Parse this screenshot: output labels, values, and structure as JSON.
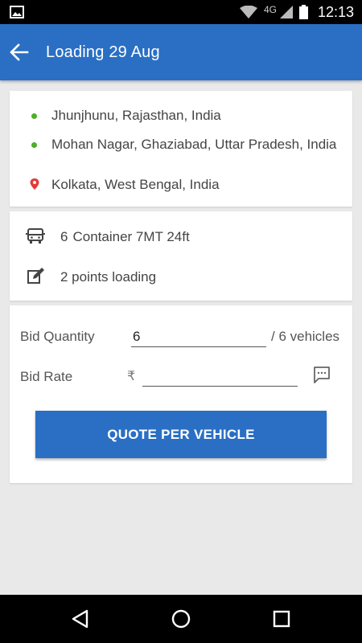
{
  "status_bar": {
    "network": "4G",
    "time": "12:13",
    "icons": [
      "gallery-icon",
      "wifi-icon",
      "signal-icon",
      "battery-icon"
    ]
  },
  "app_bar": {
    "title": "Loading 29 Aug",
    "back_icon": "arrow-left-icon"
  },
  "route": {
    "stops": [
      {
        "label": "Jhunjhunu, Rajasthan, India",
        "type": "pickup"
      },
      {
        "label": "Mohan Nagar, Ghaziabad, Uttar Pradesh, India",
        "type": "pickup"
      },
      {
        "label": "Kolkata, West Bengal, India",
        "type": "drop"
      }
    ],
    "pickup_color": "#4caf25",
    "drop_color": "#e53935"
  },
  "load_info": {
    "vehicle_count": "6",
    "vehicle_type": "Container 7MT 24ft",
    "loading_points": "2 points loading"
  },
  "bid_form": {
    "quantity_label": "Bid Quantity",
    "quantity_value": "6",
    "quantity_suffix": "/ 6 vehicles",
    "rate_label": "Bid Rate",
    "currency_symbol": "₹",
    "rate_value": "",
    "submit_label": "QUOTE PER VEHICLE"
  },
  "theme": {
    "primary": "#2a6fc4",
    "background": "#e9e9e9"
  }
}
